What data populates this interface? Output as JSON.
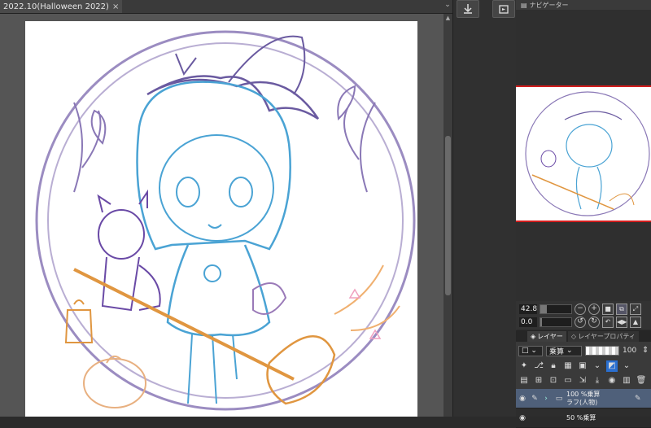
{
  "document_tab": {
    "title": "2022.10(Halloween 2022)",
    "close_glyph": "×"
  },
  "tab_menu_glyph": "⌄",
  "navigator": {
    "title": "ナビゲーター"
  },
  "nav_controls": {
    "zoom_value": "42.8",
    "angle_value": "0.0"
  },
  "layer_panel": {
    "tabs": [
      {
        "label": "レイヤー"
      },
      {
        "label": "レイヤープロパティ"
      }
    ],
    "blend_mode": "乗算",
    "opacity_value": "100",
    "layers": [
      {
        "opacity_mode": "100 %乗算",
        "name": "ラフ(人物)"
      },
      {
        "opacity_mode": "50 %乗算",
        "name": ""
      }
    ]
  },
  "colors": {
    "line_purple": "#8a78b6",
    "line_blue": "#4aa3d4",
    "line_orange": "#e6a25a",
    "selection_red": "#d21d1d",
    "layer_selected": "#4f607a"
  }
}
